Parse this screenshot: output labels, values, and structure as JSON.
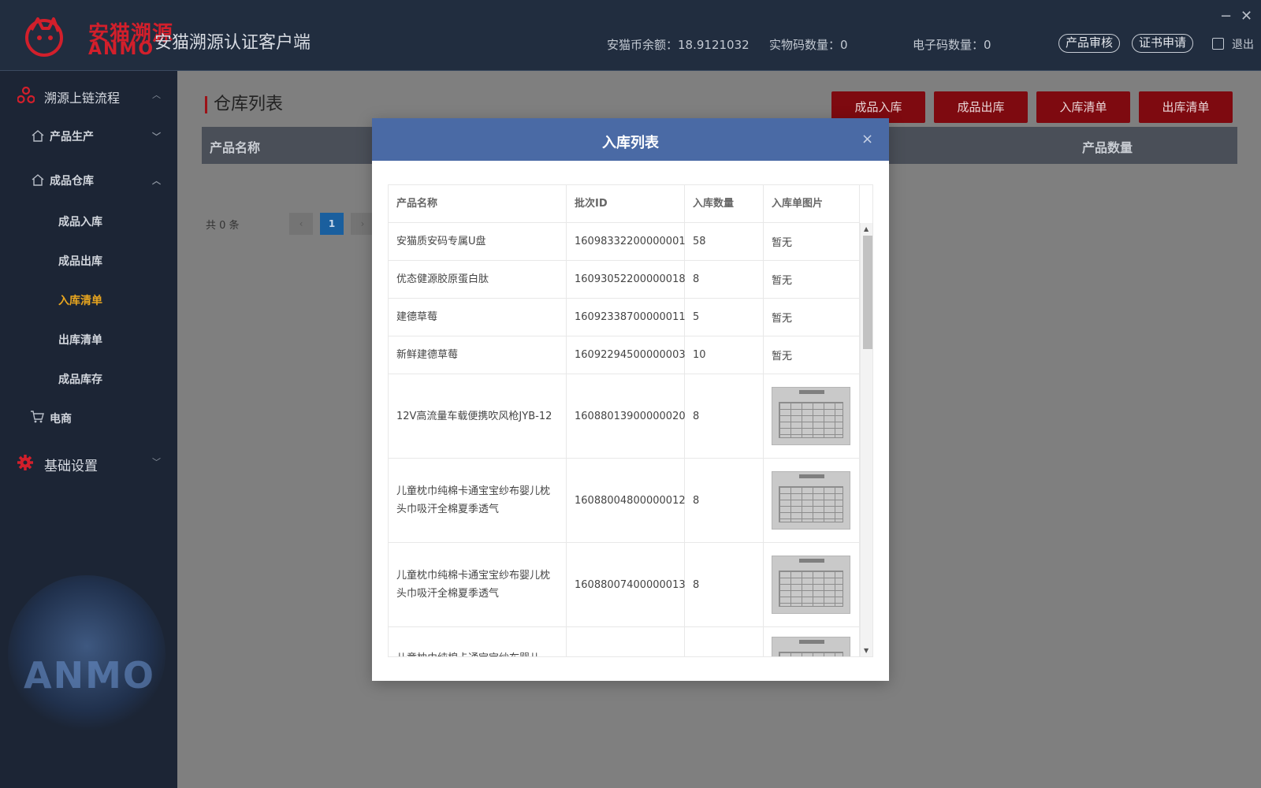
{
  "header": {
    "logo_cn": "安猫溯源",
    "logo_en": "ANMO",
    "app_title": "安猫溯源认证客户端",
    "balance": "安猫币余额：18.9121032",
    "physical_count": "实物码数量：0",
    "ecode_count": "电子码数量：0",
    "btn_audit": "产品审核",
    "btn_cert": "证书申请",
    "logout": "退出",
    "minimize": "−",
    "close": "✕"
  },
  "sidebar": {
    "section1": "溯源上链流程",
    "production": "产品生产",
    "warehouse": "成品仓库",
    "items": [
      "成品入库",
      "成品出库",
      "入库清单",
      "出库清单",
      "成品库存"
    ],
    "ecommerce": "电商",
    "settings": "基础设置",
    "watermark": "ANMO"
  },
  "main": {
    "title": "仓库列表",
    "buttons": [
      "成品入库",
      "成品出库",
      "入库清单",
      "出库清单"
    ],
    "col_product": "产品名称",
    "col_quantity": "产品数量",
    "total": "共 0 条",
    "page": "1",
    "prev": "‹",
    "next": "›"
  },
  "modal": {
    "title": "入库列表",
    "close": "×",
    "columns": [
      "产品名称",
      "批次ID",
      "入库数量",
      "入库单图片"
    ],
    "rows": [
      {
        "name": "安猫质安码专属U盘",
        "batch": "16098332200000001",
        "qty": "58",
        "image": "暂无"
      },
      {
        "name": "优态健源胶原蛋白肽",
        "batch": "16093052200000018",
        "qty": "8",
        "image": "暂无"
      },
      {
        "name": "建德草莓",
        "batch": "16092338700000011",
        "qty": "5",
        "image": "暂无"
      },
      {
        "name": "新鲜建德草莓",
        "batch": "16092294500000003",
        "qty": "10",
        "image": "暂无"
      },
      {
        "name": "12V高流量车载便携吹风枪JYB-12",
        "batch": "16088013900000020",
        "qty": "8",
        "image": ""
      },
      {
        "name": "儿童枕巾纯棉卡通宝宝纱布婴儿枕头巾吸汗全棉夏季透气",
        "batch": "16088004800000012",
        "qty": "8",
        "image": ""
      },
      {
        "name": "儿童枕巾纯棉卡通宝宝纱布婴儿枕头巾吸汗全棉夏季透气",
        "batch": "16088007400000013",
        "qty": "8",
        "image": ""
      },
      {
        "name": "儿童枕巾纯棉卡通宝宝纱布婴儿",
        "batch": "",
        "qty": "",
        "image": ""
      }
    ]
  },
  "colors": {
    "header_bg": "#212d3f",
    "sidebar_bg": "#1c2535",
    "brand_red": "#d21f2b",
    "active_menu": "#e7a51f",
    "modal_header": "#4a6aa5"
  }
}
